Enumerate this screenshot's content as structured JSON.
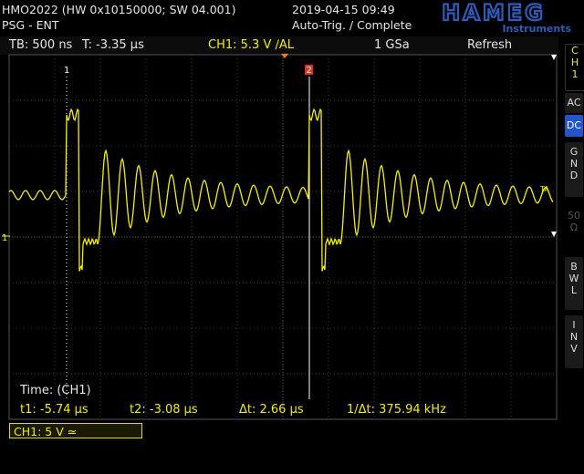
{
  "header": {
    "model_line": "HMO2022 (HW 0x10150000; SW 04.001)",
    "mode_line": "PSG - ENT",
    "datetime": "2019-04-15 09:49",
    "status": "Auto-Trig. / Complete",
    "logo_text": "HAMEG",
    "logo_sub": "Instruments"
  },
  "info_bar": {
    "timebase": "TB: 500 ns",
    "trig_pos": "T: -3.35 µs",
    "trigger": "CH1: 5.3 V ∕AL",
    "sample_rate": "1 GSa",
    "acq_mode": "Refresh"
  },
  "colors": {
    "trace": "#f5f000",
    "cursor": "#ffffff",
    "cursor2_marker": "#e03020",
    "accent": "#2255cc"
  },
  "cursors": {
    "cursor1_label": "1",
    "cursor2_label": "2",
    "trace_marker": "1",
    "trace_end_label": "TA"
  },
  "measurement": {
    "title": "Time: (CH1)",
    "t1": "t1: -5.74 µs",
    "t2": "t2: -3.08 µs",
    "dt": "Δt: 2.66 µs",
    "freq": "1/Δt: 375.94 kHz"
  },
  "channel_box": {
    "label": "CH1: 5 V ≃"
  },
  "side_menu": {
    "channel_tab": [
      "C",
      "H",
      "1"
    ],
    "ac": "AC",
    "dc": "DC",
    "gnd": [
      "G",
      "N",
      "D"
    ],
    "ohm": [
      "50",
      "Ω"
    ],
    "bwl": [
      "B",
      "W",
      "L"
    ],
    "inv": [
      "I",
      "N",
      "V"
    ]
  }
}
